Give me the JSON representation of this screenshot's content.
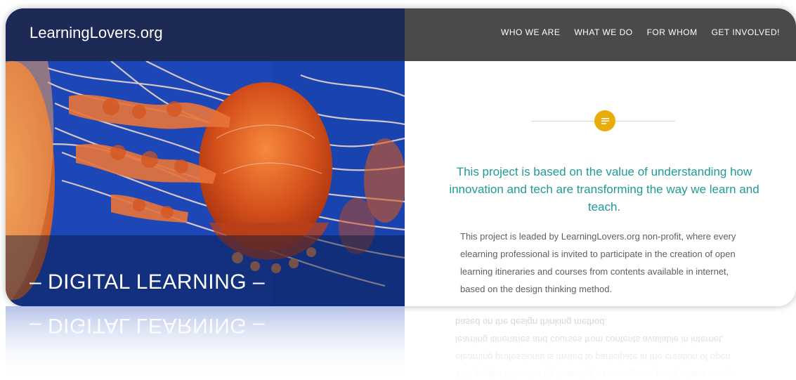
{
  "header": {
    "logo": "LearningLovers.org",
    "nav": [
      "WHO WE ARE",
      "WHAT WE DO",
      "FOR WHOM",
      "GET INVOLVED!"
    ]
  },
  "hero": {
    "banner_title": "– DIGITAL LEARNING –"
  },
  "content": {
    "icon": "document-icon",
    "headline": "This project is based on the value of understanding how innovation and tech are transforming the way we learn and teach.",
    "body": "This project is leaded by LearningLovers.org non-profit, where every elearning professional is invited to participate in the creation of open learning itineraries and courses from contents available in internet, based on the design thinking method."
  },
  "colors": {
    "header_left": "#1c2a55",
    "header_right": "#4a4a4a",
    "accent": "#1f9a96",
    "badge": "#e8ad0a",
    "sky_blue": "#1d46b6"
  }
}
